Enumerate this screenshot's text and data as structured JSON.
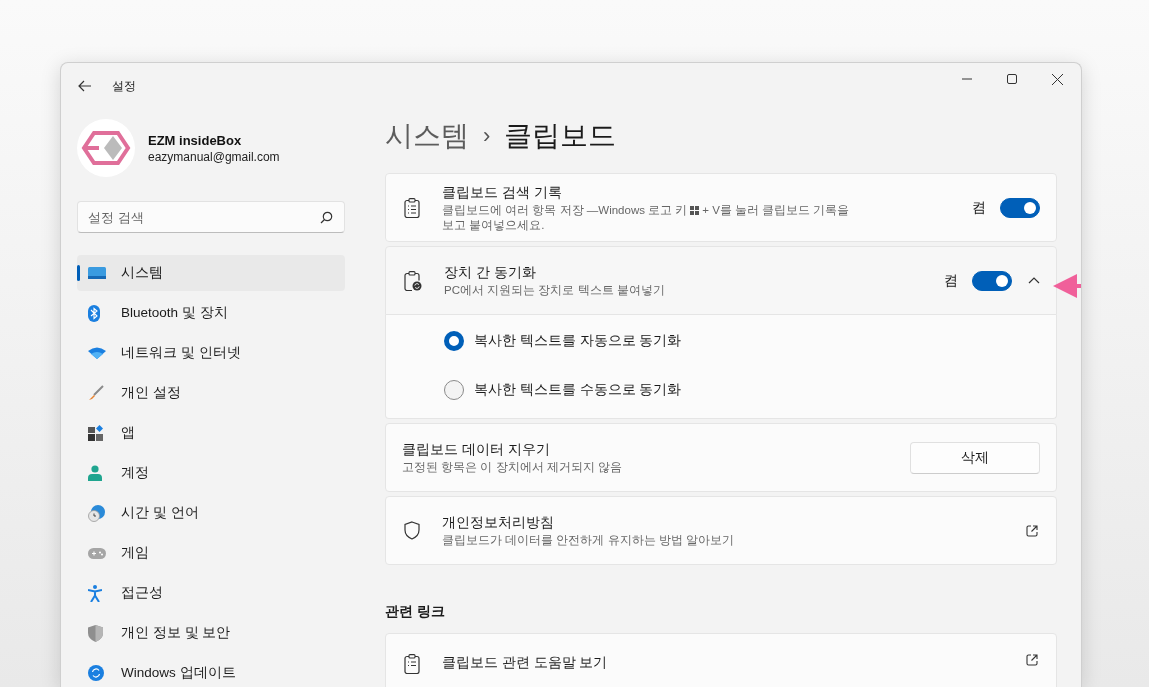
{
  "window": {
    "title": "설정"
  },
  "account": {
    "name": "EZM insideBox",
    "email": "eazymanual@gmail.com"
  },
  "search": {
    "placeholder": "설정 검색"
  },
  "sidebar": {
    "items": [
      {
        "label": "시스템",
        "selected": true
      },
      {
        "label": "Bluetooth 및 장치",
        "selected": false
      },
      {
        "label": "네트워크 및 인터넷",
        "selected": false
      },
      {
        "label": "개인 설정",
        "selected": false
      },
      {
        "label": "앱",
        "selected": false
      },
      {
        "label": "계정",
        "selected": false
      },
      {
        "label": "시간 및 언어",
        "selected": false
      },
      {
        "label": "게임",
        "selected": false
      },
      {
        "label": "접근성",
        "selected": false
      },
      {
        "label": "개인 정보 및 보안",
        "selected": false
      },
      {
        "label": "Windows 업데이트",
        "selected": false
      }
    ]
  },
  "breadcrumb": {
    "parent": "시스템",
    "separator": "›",
    "current": "클립보드"
  },
  "settings": [
    {
      "kind": "toggle",
      "title": "클립보드 검색 기록",
      "description_parts": [
        "클립보드에 여러 항목 저장 —Windows 로고 키",
        "+ V를 눌러 클립보드 기록을",
        "보고 붙여넣으세요."
      ],
      "state_label": "켬",
      "on": true
    },
    {
      "kind": "expander",
      "title": "장치 간 동기화",
      "description": "PC에서 지원되는 장치로 텍스트 붙여넣기",
      "state_label": "켬",
      "on": true,
      "expanded": true,
      "options": [
        {
          "label": "복사한 텍스트를 자동으로 동기화",
          "selected": true
        },
        {
          "label": "복사한 텍스트를 수동으로 동기화",
          "selected": false
        }
      ]
    },
    {
      "kind": "button",
      "title": "클립보드 데이터 지우기",
      "description": "고정된 항목은 이 장치에서 제거되지 않음",
      "button": "삭제"
    },
    {
      "kind": "link",
      "title": "개인정보처리방침",
      "description": "클립보드가 데이터를 안전하게 유지하는 방법 알아보기"
    }
  ],
  "related": {
    "heading": "관련 링크",
    "items": [
      {
        "title": "클립보드 관련 도움말 보기"
      }
    ]
  }
}
